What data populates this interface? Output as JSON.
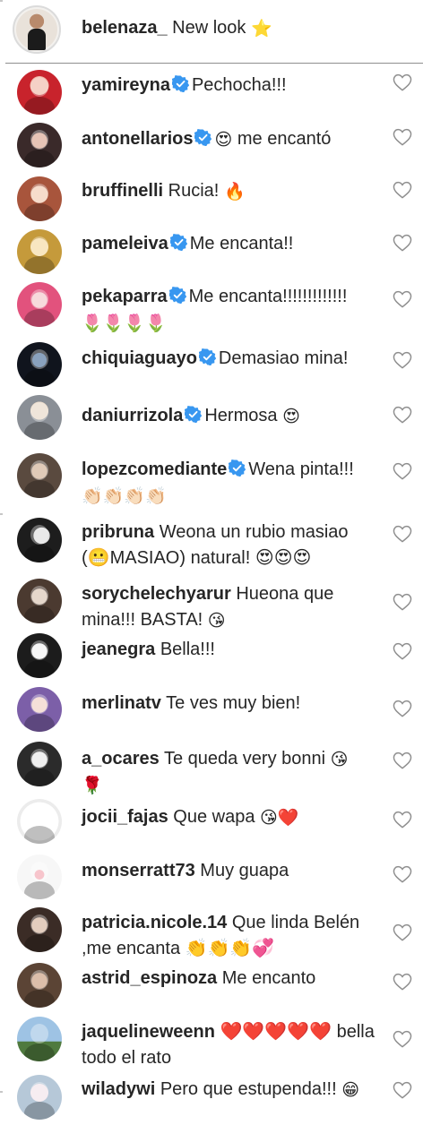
{
  "caption": {
    "username": "belenaza_",
    "text": "New look",
    "emoji": "⭐"
  },
  "icons": {
    "verified_badge": "verified-badge-icon",
    "like": "heart-outline-icon"
  },
  "colors": {
    "verified": "#3897f0",
    "text": "#262626",
    "heart_outline": "#8e8e8e"
  },
  "comments": [
    {
      "username": "yamireyna",
      "verified": true,
      "pre_emoji": "",
      "text": "Pechocha!!!",
      "emoji": "",
      "line2": ""
    },
    {
      "username": "antonellarios",
      "verified": true,
      "pre_emoji": "😍",
      "text": "me encantó",
      "emoji": "",
      "line2": ""
    },
    {
      "username": "bruffinelli",
      "verified": false,
      "pre_emoji": "",
      "text": "Rucia!",
      "emoji": "🔥",
      "line2": ""
    },
    {
      "username": "pameleiva",
      "verified": true,
      "pre_emoji": "",
      "text": "Me encanta!!",
      "emoji": "",
      "line2": ""
    },
    {
      "username": "pekaparra",
      "verified": true,
      "pre_emoji": "",
      "text": "Me encanta!!!!!!!!!!!!!",
      "emoji": "",
      "line2": "🌷🌷🌷🌷"
    },
    {
      "username": "chiquiaguayo",
      "verified": true,
      "pre_emoji": "",
      "text": "Demasiao mina!",
      "emoji": "",
      "line2": ""
    },
    {
      "username": "daniurrizola",
      "verified": true,
      "pre_emoji": "",
      "text": "Hermosa",
      "emoji": "😍",
      "line2": ""
    },
    {
      "username": "lopezcomediante",
      "verified": true,
      "pre_emoji": "",
      "text": "Wena pinta!!!",
      "emoji": "",
      "line2": "👏🏻👏🏻👏🏻👏🏻"
    },
    {
      "username": "pribruna",
      "verified": false,
      "pre_emoji": "",
      "text": "Weona un rubio masiao (😬MASIAO) natural! 😍😍😍",
      "emoji": "",
      "line2": ""
    },
    {
      "username": "sorychelechyarur",
      "verified": false,
      "pre_emoji": "",
      "text": "Hueona que mina!!! BASTA!",
      "emoji": "😘",
      "line2": ""
    },
    {
      "username": "jeanegra",
      "verified": false,
      "pre_emoji": "",
      "text": "Bella!!!",
      "emoji": "",
      "line2": ""
    },
    {
      "username": "merlinatv",
      "verified": false,
      "pre_emoji": "",
      "text": "Te ves muy bien!",
      "emoji": "",
      "line2": ""
    },
    {
      "username": "a_ocares",
      "verified": false,
      "pre_emoji": "",
      "text": "Te queda very bonni",
      "emoji": "😘",
      "line2": "🌹"
    },
    {
      "username": "jocii_fajas",
      "verified": false,
      "pre_emoji": "",
      "text": "Que wapa",
      "emoji": "😘❤️",
      "line2": ""
    },
    {
      "username": "monserratt73",
      "verified": false,
      "pre_emoji": "",
      "text": "Muy guapa",
      "emoji": "",
      "line2": ""
    },
    {
      "username": "patricia.nicole.14",
      "verified": false,
      "pre_emoji": "",
      "text": "Que linda Belén ,me encanta 👏👏👏💞",
      "emoji": "",
      "line2": ""
    },
    {
      "username": "astrid_espinoza",
      "verified": false,
      "pre_emoji": "",
      "text": "Me encanto",
      "emoji": "",
      "line2": ""
    },
    {
      "username": "jaquelineweenn",
      "verified": false,
      "pre_emoji": "",
      "text": "❤️❤️❤️❤️❤️ bella todo el rato",
      "emoji": "",
      "line2": ""
    },
    {
      "username": "wiladywi",
      "verified": false,
      "pre_emoji": "",
      "text": "Pero que estupenda!!!",
      "emoji": "😁",
      "line2": ""
    }
  ]
}
